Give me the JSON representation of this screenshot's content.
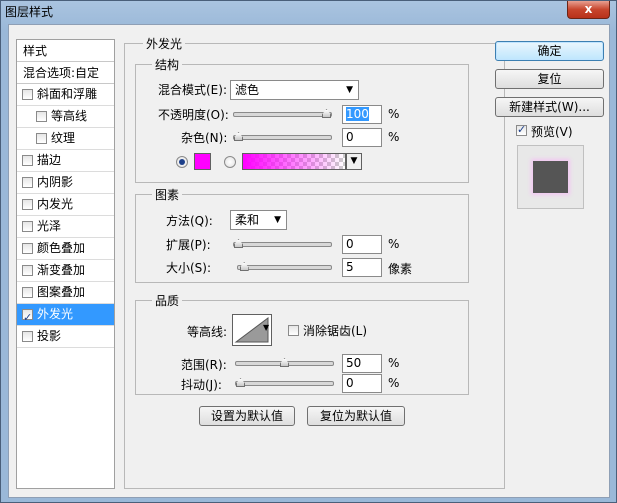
{
  "window": {
    "title": "图层样式",
    "close_label": "x"
  },
  "sidebar": {
    "header": "样式",
    "blend_options": "混合选项:自定",
    "items": [
      {
        "label": "斜面和浮雕",
        "checked": false,
        "sub": false
      },
      {
        "label": "等高线",
        "checked": false,
        "sub": true
      },
      {
        "label": "纹理",
        "checked": false,
        "sub": true
      },
      {
        "label": "描边",
        "checked": false,
        "sub": false
      },
      {
        "label": "内阴影",
        "checked": false,
        "sub": false
      },
      {
        "label": "内发光",
        "checked": false,
        "sub": false
      },
      {
        "label": "光泽",
        "checked": false,
        "sub": false
      },
      {
        "label": "颜色叠加",
        "checked": false,
        "sub": false
      },
      {
        "label": "渐变叠加",
        "checked": false,
        "sub": false
      },
      {
        "label": "图案叠加",
        "checked": false,
        "sub": false
      },
      {
        "label": "外发光",
        "checked": true,
        "sub": false,
        "active": true
      },
      {
        "label": "投影",
        "checked": false,
        "sub": false
      }
    ]
  },
  "outer_glow": {
    "title": "外发光",
    "structure": {
      "title": "结构",
      "blend_mode_label": "混合模式(E):",
      "blend_mode_value": "滤色",
      "opacity_label": "不透明度(O):",
      "opacity_value": "100",
      "opacity_unit": "%",
      "opacity_level": 1.0,
      "noise_label": "杂色(N):",
      "noise_value": "0",
      "noise_unit": "%",
      "noise_level": 0.0,
      "color": "#ff00ff",
      "color_mode": "solid"
    },
    "elements": {
      "title": "图素",
      "method_label": "方法(Q):",
      "method_value": "柔和",
      "spread_label": "扩展(P):",
      "spread_value": "0",
      "spread_unit": "%",
      "spread_level": 0.0,
      "size_label": "大小(S):",
      "size_value": "5",
      "size_unit": "像素",
      "size_level": 0.02
    },
    "quality": {
      "title": "品质",
      "contour_label": "等高线:",
      "antialias_label": "消除锯齿(L)",
      "antialias_checked": false,
      "range_label": "范围(R):",
      "range_value": "50",
      "range_unit": "%",
      "range_level": 0.5,
      "jitter_label": "抖动(J):",
      "jitter_value": "0",
      "jitter_unit": "%",
      "jitter_level": 0.0
    },
    "make_default_label": "设置为默认值",
    "reset_default_label": "复位为默认值"
  },
  "actions": {
    "ok_label": "确定",
    "reset_label": "复位",
    "new_style_label": "新建样式(W)...",
    "preview_label": "预览(V)",
    "preview_checked": true
  }
}
